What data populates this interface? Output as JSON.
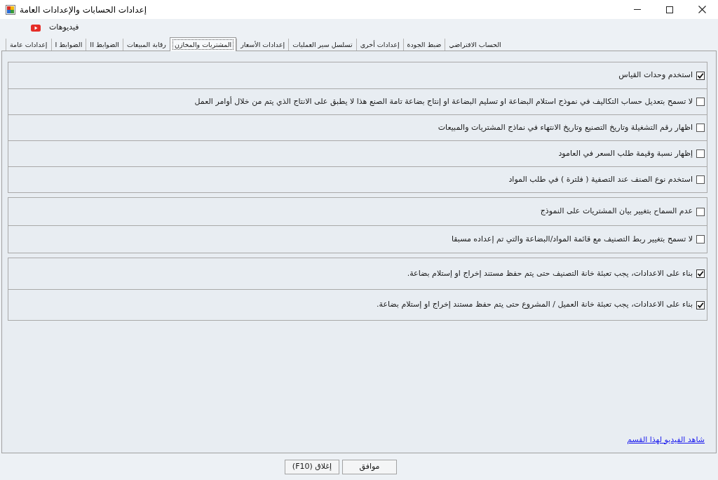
{
  "window": {
    "title": "إعدادات الحسابات والإعدادات العامة"
  },
  "menu": [
    {
      "label": "فيديوهات"
    }
  ],
  "tabs": [
    {
      "label": "الحساب الافتراضي",
      "selected": false
    },
    {
      "label": "ضبط الجودة",
      "selected": false
    },
    {
      "label": "إعدادات أخرى",
      "selected": false
    },
    {
      "label": "تسلسل سير العمليات",
      "selected": false
    },
    {
      "label": "إعدادات الأسعار",
      "selected": false
    },
    {
      "label": "المشتريات والمخازن",
      "selected": true
    },
    {
      "label": "رقابة المبيعات",
      "selected": false
    },
    {
      "label": "الضوابط II",
      "selected": false
    },
    {
      "label": "الضوابط I",
      "selected": false
    },
    {
      "label": "إعدادات عامة",
      "selected": false
    }
  ],
  "groups": [
    {
      "options": [
        {
          "label": "استخدم وحدات القياس",
          "checked": true
        },
        {
          "label": "لا تسمح بتعديل حساب التكاليف في نموذج استلام البضاعة او تسليم البضاعة او إنتاج بضاعة تامة الصنع هذا لا يطبق على الانتاج الذي يتم من خلال أوامر العمل",
          "checked": false
        },
        {
          "label": "اظهار رقم التشغيلة وتاريخ التصنيع وتاريخ الانتهاء في نماذج المشتريات والمبيعات",
          "checked": false
        },
        {
          "label": "إظهار نسبة وقيمة طلب السعر في العامود",
          "checked": false
        },
        {
          "label": "استخدم نوع الصنف عند التصفية ( فلترة ) في طلب المواد",
          "checked": false
        }
      ]
    },
    {
      "options": [
        {
          "label": "عدم السماح بتغيير بيان المشتريات على النموذج",
          "checked": false
        },
        {
          "label": "لا تسمح بتغيير ربط التصنيف مع قائمة المواد/البضاعة والتي تم إعداده مسبقا",
          "checked": false
        }
      ]
    },
    {
      "options": [
        {
          "label": "بناء على الاعدادات، يجب تعبئة خانة التصنيف حتى يتم حفظ مستند إخراج او إستلام بضاعة.",
          "checked": true
        },
        {
          "label": "بناء على الاعدادات، يجب تعبئة خانة العميل / المشروع حتى يتم حفظ مستند إخراج او إستلام بضاعة.",
          "checked": true
        }
      ]
    }
  ],
  "video_link": "شاهد الفيديو لهذا القسم",
  "buttons": [
    {
      "label": "موافق"
    },
    {
      "label": "إغلاق (F10)"
    }
  ]
}
